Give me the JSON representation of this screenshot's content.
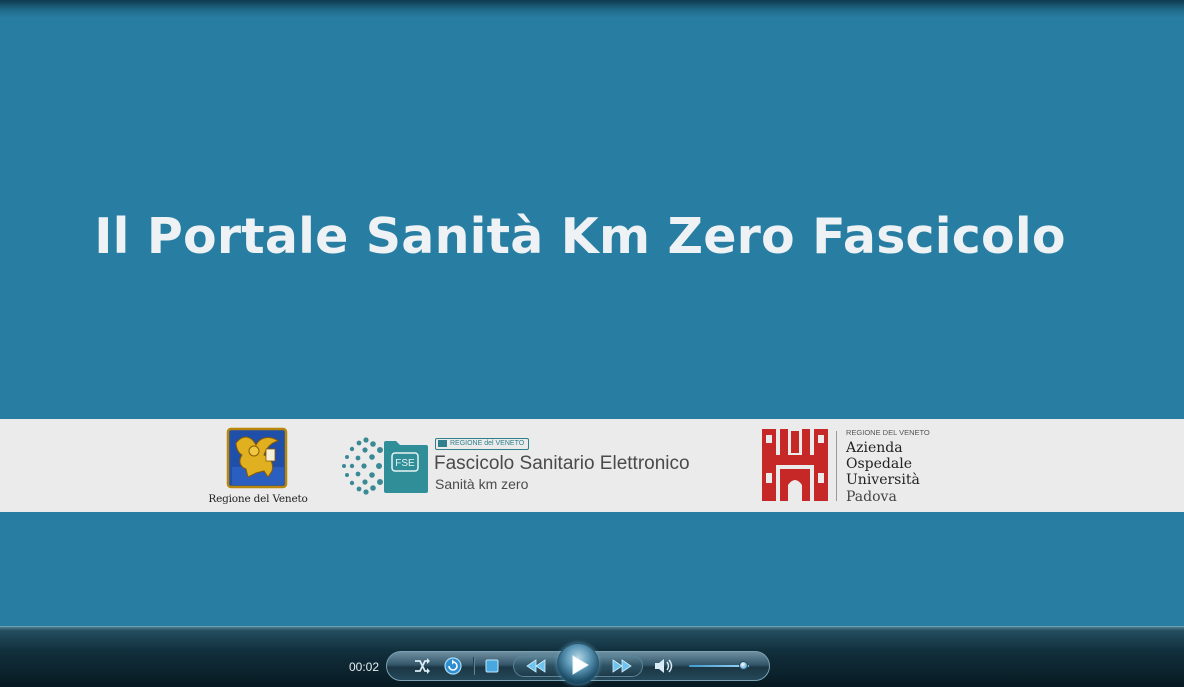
{
  "slide": {
    "title": "Il Portale Sanità Km Zero Fascicolo"
  },
  "logos": {
    "regione_veneto": {
      "label": "Regione del Veneto"
    },
    "fse": {
      "badge_text": "FSE",
      "region_tag": "REGIONE del VENETO",
      "title": "Fascicolo Sanitario Elettronico",
      "subtitle": "Sanità km zero"
    },
    "azienda_ospedale": {
      "region_tag": "REGIONE DEL VENETO",
      "name_lines": [
        "Azienda",
        "Ospedale",
        "Università",
        "Padova"
      ]
    }
  },
  "player": {
    "current_time": "00:02",
    "volume_level": 0.9,
    "controls": [
      {
        "name": "shuffle-icon"
      },
      {
        "name": "repeat-icon"
      },
      {
        "name": "stop-icon"
      },
      {
        "name": "previous-icon"
      },
      {
        "name": "play-icon"
      },
      {
        "name": "next-icon"
      },
      {
        "name": "volume-icon"
      }
    ]
  },
  "colors": {
    "background": "#287ea2",
    "title_text": "#eef2f4",
    "logo_band": "#ebebeb",
    "fse_teal": "#2f7f8c",
    "aopd_red": "#c62828",
    "player_dark": "#0e2733"
  }
}
